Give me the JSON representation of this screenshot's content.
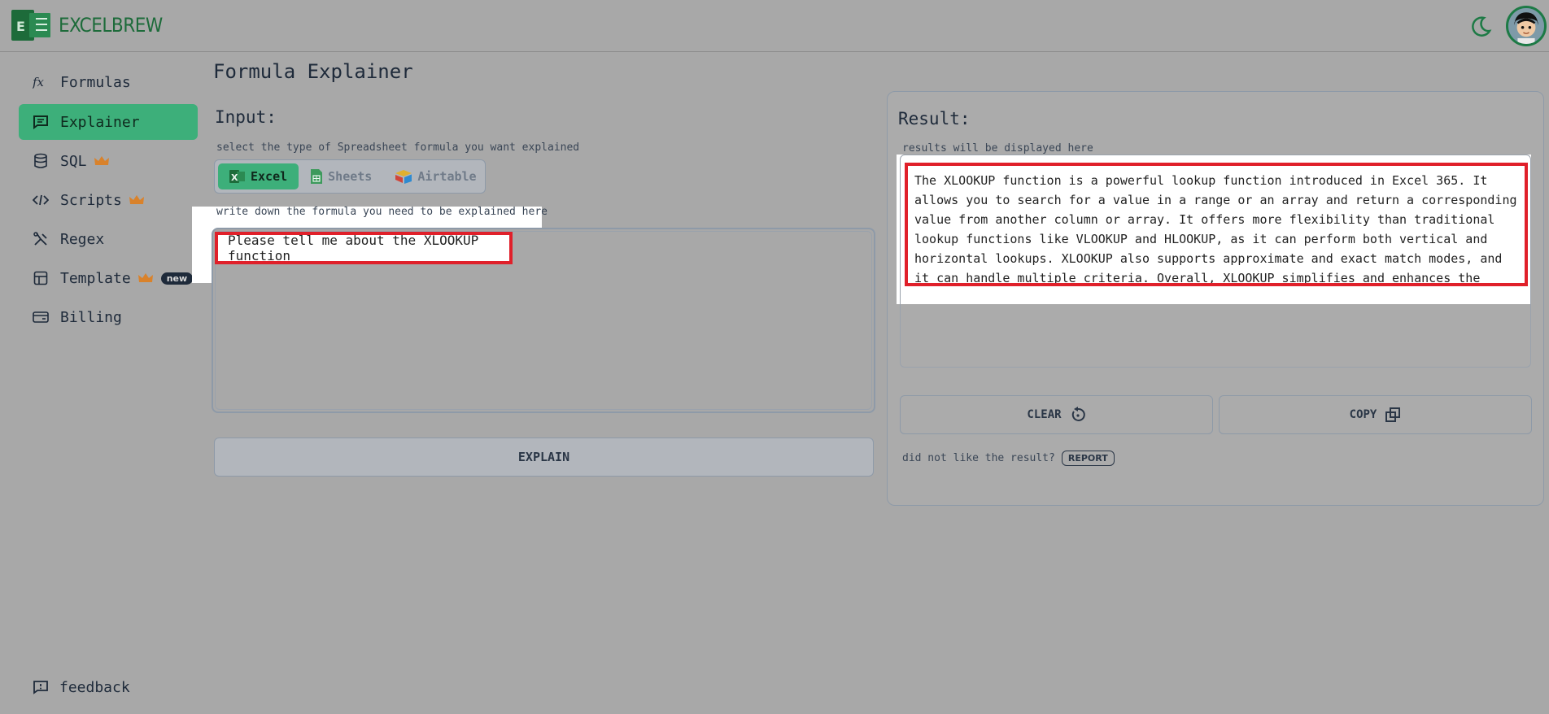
{
  "app": {
    "name": "EXCELBREW"
  },
  "sidebar": {
    "items": [
      {
        "label": "Formulas",
        "icon": "fx-icon",
        "premium": false
      },
      {
        "label": "Explainer",
        "icon": "message-icon",
        "premium": false,
        "active": true
      },
      {
        "label": "SQL",
        "icon": "database-icon",
        "premium": true
      },
      {
        "label": "Scripts",
        "icon": "code-icon",
        "premium": true
      },
      {
        "label": "Regex",
        "icon": "regex-icon",
        "premium": false
      },
      {
        "label": "Template",
        "icon": "table-icon",
        "premium": true,
        "badge": "new"
      },
      {
        "label": "Billing",
        "icon": "card-icon",
        "premium": false
      }
    ],
    "feedback": "feedback"
  },
  "main": {
    "title": "Formula Explainer",
    "input_label": "Input:",
    "select_hint": "select the type of Spreadsheet formula you want explained",
    "types": [
      "Excel",
      "Sheets",
      "Airtable"
    ],
    "selected_type": "Excel",
    "formula_hint": "write down the formula you need to be explained here",
    "query": "Please tell me about the XLOOKUP function",
    "explain_button": "EXPLAIN"
  },
  "result": {
    "label": "Result:",
    "hint": "results will be displayed here",
    "text": "The XLOOKUP function is a powerful lookup function introduced in Excel 365. It allows you to search for a value in a range or an array and return a corresponding value from another column or array. It offers more flexibility than traditional lookup functions like VLOOKUP and HLOOKUP, as it can perform both vertical and horizontal lookups. XLOOKUP also supports approximate and exact match modes, and it can handle multiple criteria. Overall, XLOOKUP simplifies and enhances the lookup process in",
    "clear_button": "CLEAR",
    "copy_button": "COPY",
    "dislike_text": "did not like the result?",
    "report_button": "REPORT"
  },
  "colors": {
    "accent": "#3daf7a",
    "highlight_border": "#e0202a",
    "brand_green": "#1d6b3a"
  }
}
